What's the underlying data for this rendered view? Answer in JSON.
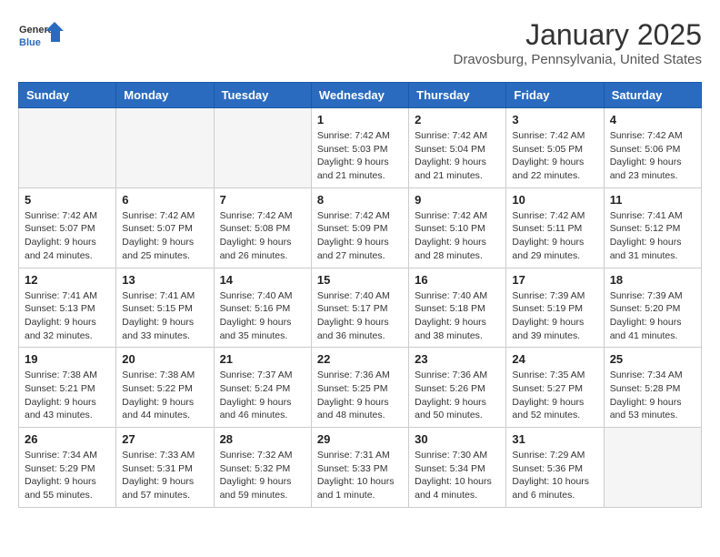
{
  "logo": {
    "line1": "General",
    "line2": "Blue"
  },
  "title": "January 2025",
  "subtitle": "Dravosburg, Pennsylvania, United States",
  "weekdays": [
    "Sunday",
    "Monday",
    "Tuesday",
    "Wednesday",
    "Thursday",
    "Friday",
    "Saturday"
  ],
  "weeks": [
    [
      {
        "day": "",
        "detail": ""
      },
      {
        "day": "",
        "detail": ""
      },
      {
        "day": "",
        "detail": ""
      },
      {
        "day": "1",
        "detail": "Sunrise: 7:42 AM\nSunset: 5:03 PM\nDaylight: 9 hours\nand 21 minutes."
      },
      {
        "day": "2",
        "detail": "Sunrise: 7:42 AM\nSunset: 5:04 PM\nDaylight: 9 hours\nand 21 minutes."
      },
      {
        "day": "3",
        "detail": "Sunrise: 7:42 AM\nSunset: 5:05 PM\nDaylight: 9 hours\nand 22 minutes."
      },
      {
        "day": "4",
        "detail": "Sunrise: 7:42 AM\nSunset: 5:06 PM\nDaylight: 9 hours\nand 23 minutes."
      }
    ],
    [
      {
        "day": "5",
        "detail": "Sunrise: 7:42 AM\nSunset: 5:07 PM\nDaylight: 9 hours\nand 24 minutes."
      },
      {
        "day": "6",
        "detail": "Sunrise: 7:42 AM\nSunset: 5:07 PM\nDaylight: 9 hours\nand 25 minutes."
      },
      {
        "day": "7",
        "detail": "Sunrise: 7:42 AM\nSunset: 5:08 PM\nDaylight: 9 hours\nand 26 minutes."
      },
      {
        "day": "8",
        "detail": "Sunrise: 7:42 AM\nSunset: 5:09 PM\nDaylight: 9 hours\nand 27 minutes."
      },
      {
        "day": "9",
        "detail": "Sunrise: 7:42 AM\nSunset: 5:10 PM\nDaylight: 9 hours\nand 28 minutes."
      },
      {
        "day": "10",
        "detail": "Sunrise: 7:42 AM\nSunset: 5:11 PM\nDaylight: 9 hours\nand 29 minutes."
      },
      {
        "day": "11",
        "detail": "Sunrise: 7:41 AM\nSunset: 5:12 PM\nDaylight: 9 hours\nand 31 minutes."
      }
    ],
    [
      {
        "day": "12",
        "detail": "Sunrise: 7:41 AM\nSunset: 5:13 PM\nDaylight: 9 hours\nand 32 minutes."
      },
      {
        "day": "13",
        "detail": "Sunrise: 7:41 AM\nSunset: 5:15 PM\nDaylight: 9 hours\nand 33 minutes."
      },
      {
        "day": "14",
        "detail": "Sunrise: 7:40 AM\nSunset: 5:16 PM\nDaylight: 9 hours\nand 35 minutes."
      },
      {
        "day": "15",
        "detail": "Sunrise: 7:40 AM\nSunset: 5:17 PM\nDaylight: 9 hours\nand 36 minutes."
      },
      {
        "day": "16",
        "detail": "Sunrise: 7:40 AM\nSunset: 5:18 PM\nDaylight: 9 hours\nand 38 minutes."
      },
      {
        "day": "17",
        "detail": "Sunrise: 7:39 AM\nSunset: 5:19 PM\nDaylight: 9 hours\nand 39 minutes."
      },
      {
        "day": "18",
        "detail": "Sunrise: 7:39 AM\nSunset: 5:20 PM\nDaylight: 9 hours\nand 41 minutes."
      }
    ],
    [
      {
        "day": "19",
        "detail": "Sunrise: 7:38 AM\nSunset: 5:21 PM\nDaylight: 9 hours\nand 43 minutes."
      },
      {
        "day": "20",
        "detail": "Sunrise: 7:38 AM\nSunset: 5:22 PM\nDaylight: 9 hours\nand 44 minutes."
      },
      {
        "day": "21",
        "detail": "Sunrise: 7:37 AM\nSunset: 5:24 PM\nDaylight: 9 hours\nand 46 minutes."
      },
      {
        "day": "22",
        "detail": "Sunrise: 7:36 AM\nSunset: 5:25 PM\nDaylight: 9 hours\nand 48 minutes."
      },
      {
        "day": "23",
        "detail": "Sunrise: 7:36 AM\nSunset: 5:26 PM\nDaylight: 9 hours\nand 50 minutes."
      },
      {
        "day": "24",
        "detail": "Sunrise: 7:35 AM\nSunset: 5:27 PM\nDaylight: 9 hours\nand 52 minutes."
      },
      {
        "day": "25",
        "detail": "Sunrise: 7:34 AM\nSunset: 5:28 PM\nDaylight: 9 hours\nand 53 minutes."
      }
    ],
    [
      {
        "day": "26",
        "detail": "Sunrise: 7:34 AM\nSunset: 5:29 PM\nDaylight: 9 hours\nand 55 minutes."
      },
      {
        "day": "27",
        "detail": "Sunrise: 7:33 AM\nSunset: 5:31 PM\nDaylight: 9 hours\nand 57 minutes."
      },
      {
        "day": "28",
        "detail": "Sunrise: 7:32 AM\nSunset: 5:32 PM\nDaylight: 9 hours\nand 59 minutes."
      },
      {
        "day": "29",
        "detail": "Sunrise: 7:31 AM\nSunset: 5:33 PM\nDaylight: 10 hours\nand 1 minute."
      },
      {
        "day": "30",
        "detail": "Sunrise: 7:30 AM\nSunset: 5:34 PM\nDaylight: 10 hours\nand 4 minutes."
      },
      {
        "day": "31",
        "detail": "Sunrise: 7:29 AM\nSunset: 5:36 PM\nDaylight: 10 hours\nand 6 minutes."
      },
      {
        "day": "",
        "detail": ""
      }
    ]
  ]
}
